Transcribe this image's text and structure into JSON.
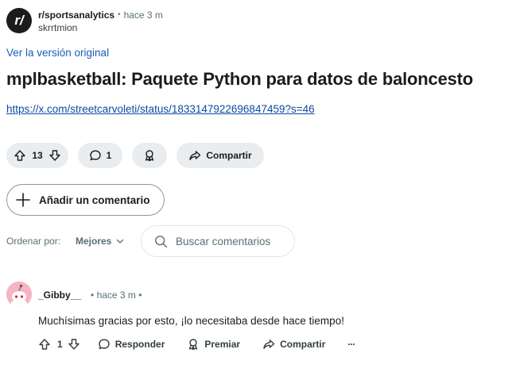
{
  "subreddit": {
    "avatar_text": "r/",
    "name": "r/sportsanalytics",
    "separator": "•",
    "time": "hace 3 m",
    "author": "skrrtmion"
  },
  "post": {
    "original_link": "Ver la versión original",
    "title": "mplbasketball: Paquete Python para datos de baloncesto",
    "url": "https://x.com/streetcarvoleti/status/1833147922696847459?s=46"
  },
  "actions": {
    "votes": "13",
    "comments": "1",
    "share": "Compartir"
  },
  "add_comment": "Añadir un comentario",
  "sort": {
    "label": "Ordenar por:",
    "value": "Mejores"
  },
  "search": {
    "placeholder": "Buscar comentarios"
  },
  "comment": {
    "author": "_Gibby__",
    "meta": "• hace 3 m •",
    "body": "Muchísimas gracias por esto, ¡lo necesitaba desde hace tiempo!",
    "votes": "1",
    "reply": "Responder",
    "award": "Premiar",
    "share": "Compartir",
    "more": "···"
  },
  "colors": {
    "pill_bg": "#eaedef",
    "link": "#0b4aa3",
    "avatar_pink": "#f6b3c2",
    "subreddit_avatar": "#1c1c1c"
  }
}
